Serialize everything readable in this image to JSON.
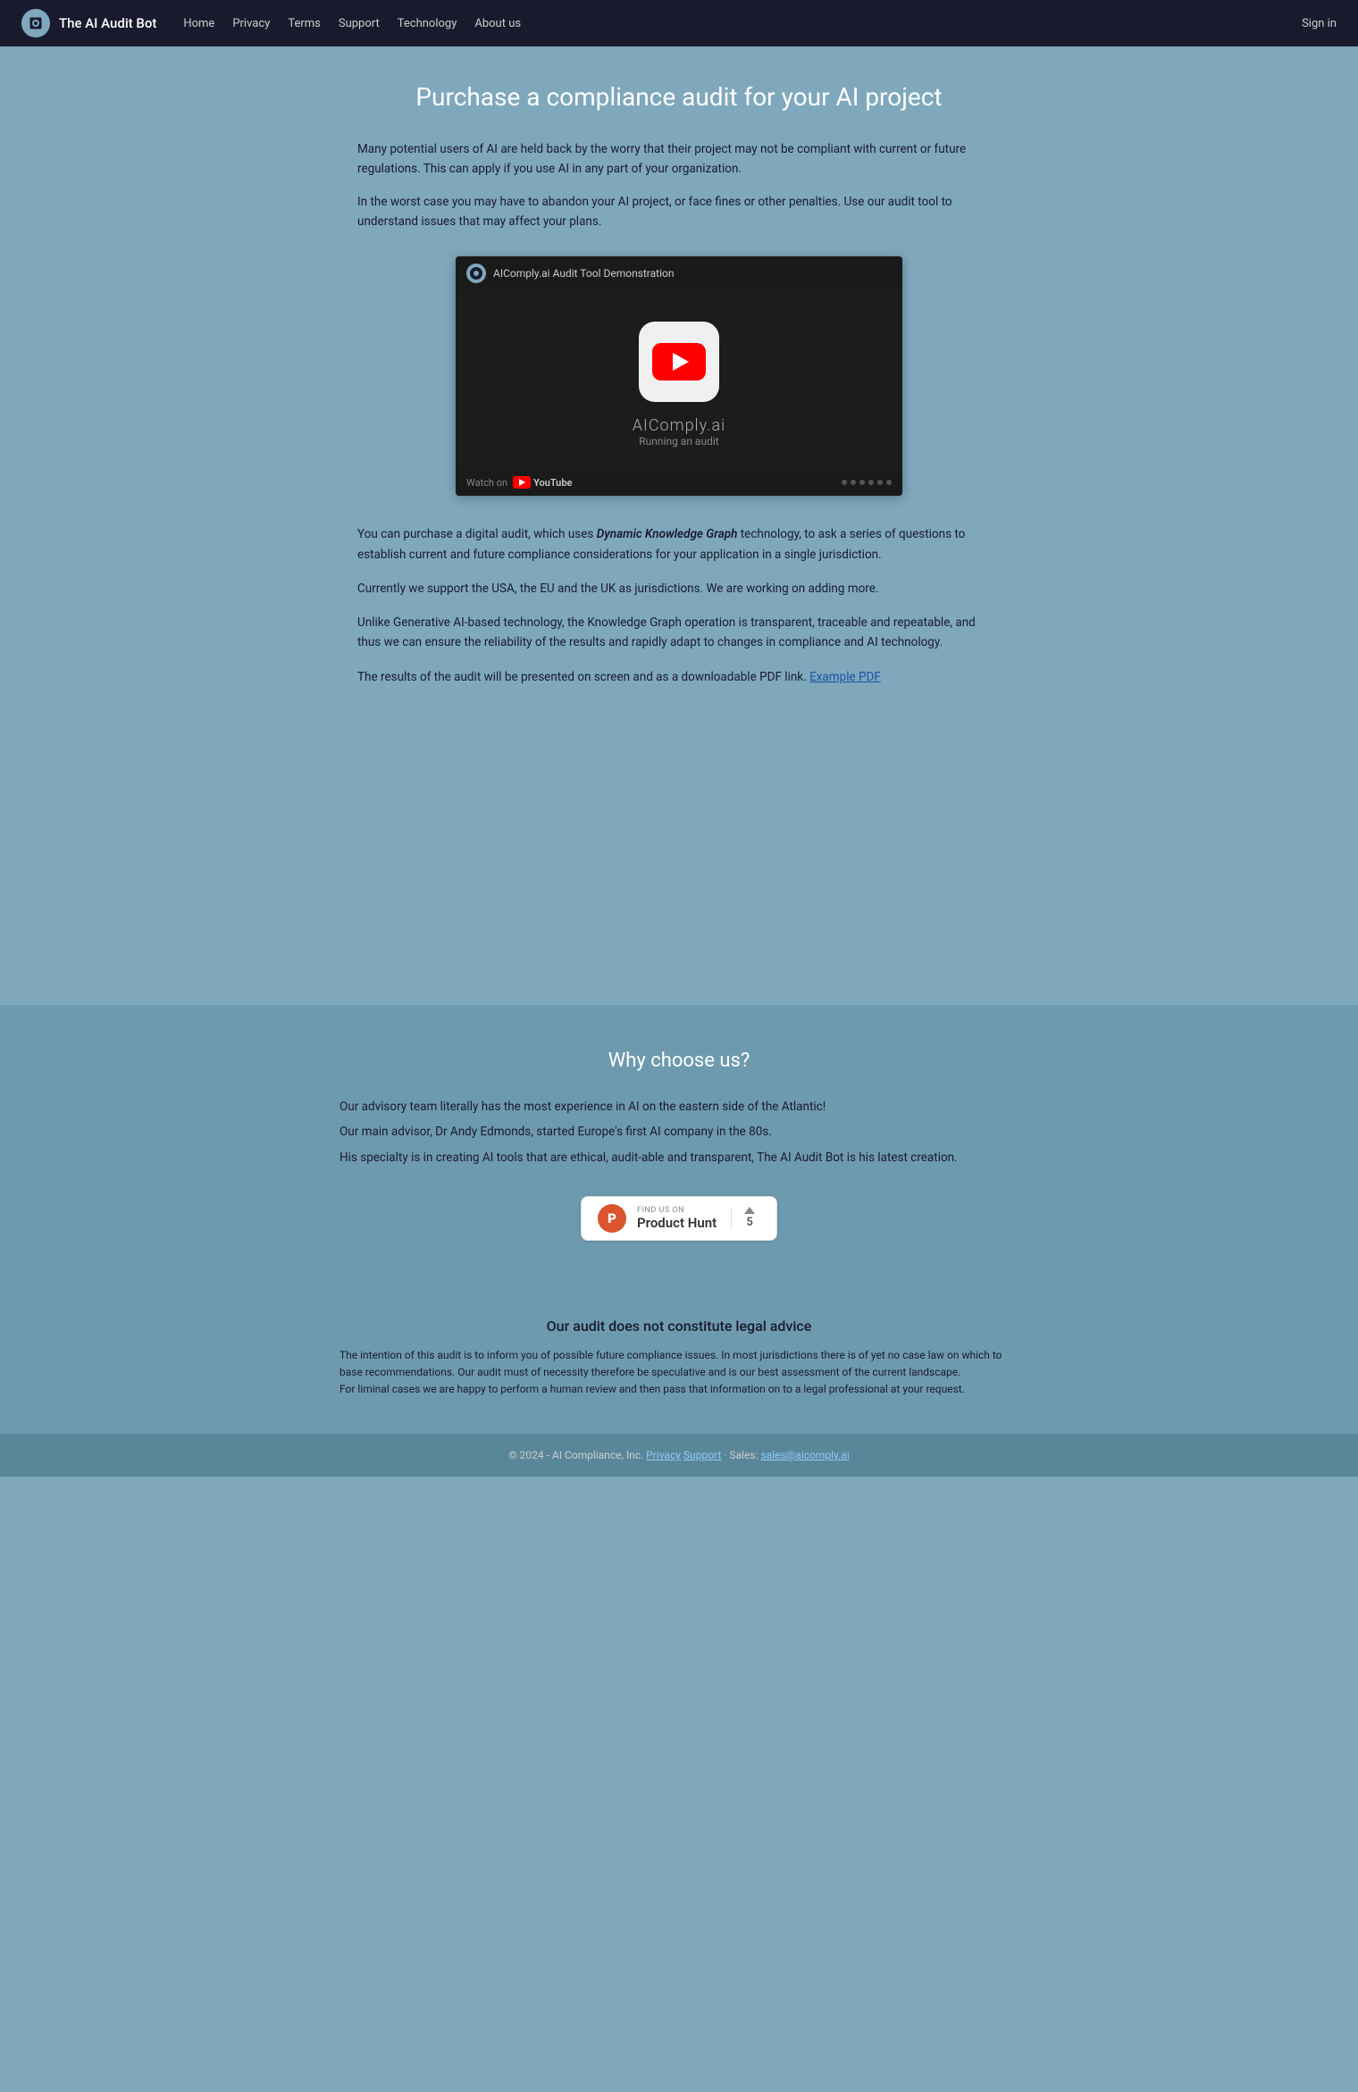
{
  "navbar": {
    "brand_title": "The AI Audit Bot",
    "links": [
      {
        "label": "Home",
        "href": "#"
      },
      {
        "label": "Privacy",
        "href": "#"
      },
      {
        "label": "Terms",
        "href": "#"
      },
      {
        "label": "Support",
        "href": "#"
      },
      {
        "label": "Technology",
        "href": "#"
      },
      {
        "label": "About us",
        "href": "#"
      }
    ],
    "signin_label": "Sign in"
  },
  "hero": {
    "title": "Purchase a compliance audit for your AI project"
  },
  "intro": {
    "p1": "Many potential users of AI are held back by the worry that their project may not be compliant with current or future regulations. This can apply if you use AI in any part of your organization.",
    "p2": "In the worst case you may have to abandon your AI project, or face fines or other penalties. Use our audit tool to understand issues that may affect your plans."
  },
  "video": {
    "header_title": "AIComply.ai Audit Tool Demonstration",
    "brand": "AIComply.ai",
    "subtitle": "Running an audit",
    "watch_on": "Watch on",
    "yt_label": "YouTube"
  },
  "body": {
    "p1_text": "You can purchase a digital audit, which uses ",
    "p1_em": "Dynamic Knowledge Graph",
    "p1_rest": " technology, to ask a series of questions to establish current and future compliance considerations for your application in a single jurisdiction.",
    "p2": "Currently we support the USA, the EU and the UK as jurisdictions. We are working on adding more.",
    "p3": "Unlike Generative AI-based technology, the Knowledge Graph operation is transparent, traceable and repeatable, and thus we can ensure the reliability of the results and rapidly adapt to changes in compliance and AI technology.",
    "p4_pre": "The results of the audit will be presented on screen and as a downloadable PDF link. ",
    "p4_link": "Example PDF"
  },
  "why": {
    "title": "Why choose us?",
    "lines": [
      "Our advisory team literally has the most experience in AI on the eastern side of the Atlantic!",
      "Our main advisor, Dr Andy Edmonds, started Europe's first AI company in the 80s.",
      "His specialty is in creating AI tools that are ethical, audit-able and transparent, The AI Audit Bot is his latest creation."
    ]
  },
  "product_hunt": {
    "find_us": "FIND US ON",
    "name": "Product Hunt",
    "score": "5"
  },
  "legal": {
    "title": "Our audit does not constitute legal advice",
    "text": "The intention of this audit is to inform you of possible future compliance issues. In most jurisdictions there is of yet no case law on which to base recommendations. Our audit must of necessity therefore be speculative and is our best assessment of the current landscape.\nFor liminal cases we are happy to perform a human review and then pass that information on to a legal professional at your request."
  },
  "footer": {
    "copyright": "© 2024 - AI Compliance, Inc.",
    "privacy_label": "Privacy",
    "support_label": "Support",
    "sales_pre": " · Sales: ",
    "sales_email": "sales@aicomply.ai"
  }
}
